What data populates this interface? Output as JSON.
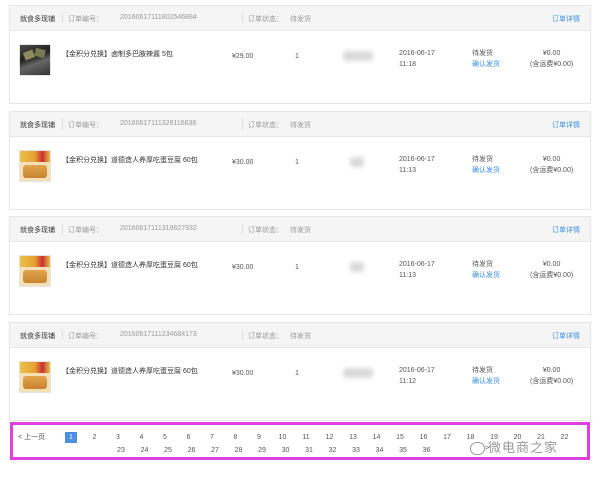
{
  "labels": {
    "order_no": "订单编号：",
    "order_status": "订单状态：",
    "detail": "订单详情",
    "confirm": "确认发货",
    "freight_suffix": "(含运费¥0.00)"
  },
  "orders": [
    {
      "shop": "就食多现铺",
      "order_no": "20160617111802546884",
      "status": "待发货",
      "product_image": "chocolate-snack-image",
      "product_name": "【金积分兑换】卤制多巴胺辣酱 5包",
      "price": "¥29.00",
      "qty": "1",
      "time_date": "2016-06-17",
      "time_clock": "11:18",
      "row_status": "待发货",
      "show_confirm": true,
      "total": "¥0.00",
      "freight": "(含运费¥0.00)"
    },
    {
      "shop": "就食多现铺",
      "order_no": "20160617111328116638",
      "status": "待发货",
      "product_image": "cake-snack-image",
      "product_name": "【金积分兑换】道德造人养厚吃蛋豆腐 60包",
      "price": "¥30.00",
      "qty": "1",
      "time_date": "2016-06-17",
      "time_clock": "11:13",
      "row_status": "待发货",
      "show_confirm": true,
      "total": "¥0.00",
      "freight": "(含运费¥0.00)"
    },
    {
      "shop": "就食多现铺",
      "order_no": "20160617111319627932",
      "status": "待发货",
      "product_image": "cake-snack-image",
      "product_name": "【金积分兑换】道德造人养厚吃蛋豆腐 60包",
      "price": "¥30.00",
      "qty": "1",
      "time_date": "2016-06-17",
      "time_clock": "11:13",
      "row_status": "待发货",
      "show_confirm": true,
      "total": "¥0.00",
      "freight": "(含运费¥0.00)"
    },
    {
      "shop": "就食多现铺",
      "order_no": "20160617111234684173",
      "status": "待发货",
      "product_image": "cake-snack-image",
      "product_name": "【金积分兑换】道德造人养厚吃蛋豆腐 60包",
      "price": "¥30.00",
      "qty": "1",
      "time_date": "2016-06-17",
      "time_clock": "11:12",
      "row_status": "待发货",
      "show_confirm": true,
      "total": "¥0.00",
      "freight": "(含运费¥0.00)"
    }
  ],
  "pagination": {
    "prev_label": "上一页",
    "next_label": ">",
    "current_page": 1,
    "pages": [
      "1",
      "2",
      "3",
      "4",
      "5",
      "6",
      "7",
      "8",
      "9",
      "10",
      "11",
      "12",
      "13",
      "14",
      "15",
      "16",
      "17",
      "18",
      "19",
      "20",
      "21",
      "22",
      "23",
      "24",
      "25",
      "26",
      "27",
      "28",
      "29",
      "30",
      "31",
      "32",
      "33",
      "34",
      "35",
      "36"
    ],
    "highlight_color": "#e040e0",
    "active_color": "#4a90e2"
  },
  "watermark": {
    "text": "微电商之家",
    "icon": "wechat-icon"
  }
}
